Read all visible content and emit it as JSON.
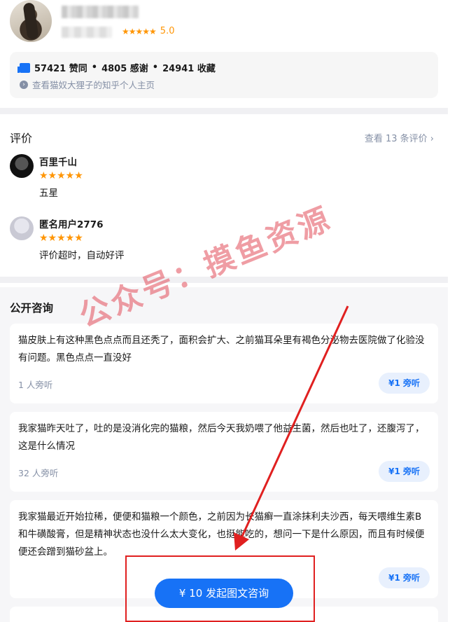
{
  "profile": {
    "rating_stars": "★★★★★",
    "rating_score": "5.0"
  },
  "stats": {
    "likes": "57421 赞同",
    "thanks": "4805 感谢",
    "favorites": "24941 收藏",
    "separator": "•",
    "profile_link": "查看猫奴大狸子的知乎个人主页"
  },
  "reviews": {
    "title": "评价",
    "more": "查看 13 条评价",
    "items": [
      {
        "name": "百里千山",
        "stars": "★★★★★",
        "text": "五星"
      },
      {
        "name": "匿名用户2776",
        "stars": "★★★★★",
        "text": "评价超时，自动好评"
      }
    ]
  },
  "consult": {
    "title": "公开咨询",
    "items": [
      {
        "question": "猫皮肤上有这种黑色点点而且还秃了，面积会扩大、之前猫耳朵里有褐色分泌物去医院做了化验没有问题。黑色点点一直没好",
        "listeners": "1 人旁听",
        "price_label": "¥1 旁听"
      },
      {
        "question": "我家猫昨天吐了，吐的是没消化完的猫粮，然后今天我奶喂了他益生菌，然后也吐了，还腹泻了，这是什么情况",
        "listeners": "32 人旁听",
        "price_label": "¥1 旁听"
      },
      {
        "question": "我家猫最近开始拉稀，便便和猫粮一个颜色，之前因为长猫癣一直涂抹利夫沙西，每天喂维生素B和牛磺酸膏，但是精神状态也没什么太大变化，也挺能吃的，想问一下是什么原因，而且有时候便便还会蹭到猫砂盆上。",
        "listeners": "",
        "price_label": "¥1 旁听"
      }
    ]
  },
  "cta": {
    "label": "¥ 10 发起图文咨询"
  },
  "watermark": {
    "text": "公众号：摸鱼资源"
  },
  "colors": {
    "accent": "#1772f6",
    "star": "#ff9607",
    "annotation": "#e02020"
  }
}
